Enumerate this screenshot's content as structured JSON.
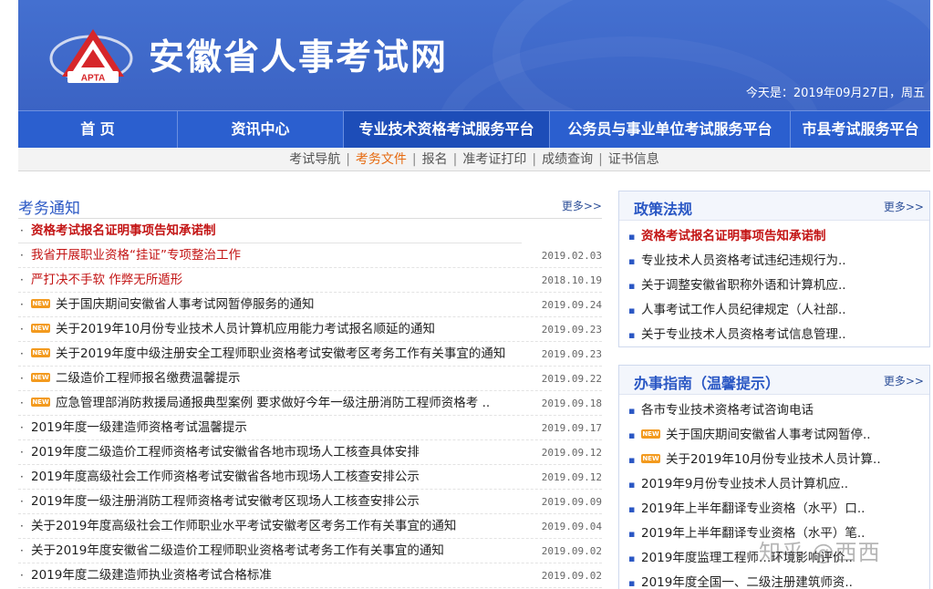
{
  "header": {
    "site_title": "安徽省人事考试网",
    "logo_text": "APTA",
    "date_line": "今天是：2019年09月27日，周五"
  },
  "main_nav": [
    {
      "label": "首  页"
    },
    {
      "label": "资讯中心"
    },
    {
      "label": "专业技术资格考试服务平台"
    },
    {
      "label": "公务员与事业单位考试服务平台"
    },
    {
      "label": "市县考试服务平台"
    }
  ],
  "sub_nav": [
    {
      "label": "考试导航"
    },
    {
      "label": "考务文件"
    },
    {
      "label": "报名"
    },
    {
      "label": "准考证打印"
    },
    {
      "label": "成绩查询"
    },
    {
      "label": "证书信息"
    }
  ],
  "exam_notice": {
    "title": "考务通知",
    "more": "更多>>",
    "items": [
      {
        "text": "资格考试报名证明事项告知承诺制",
        "date": ""
      },
      {
        "text": "我省开展职业资格“挂证”专项整治工作",
        "date": "2019.02.03"
      },
      {
        "text": "严打决不手软 作弊无所遁形",
        "date": "2018.10.19"
      },
      {
        "text": "关于国庆期间安徽省人事考试网暂停服务的通知",
        "date": "2019.09.24",
        "new": "NEW"
      },
      {
        "text": "关于2019年10月份专业技术人员计算机应用能力考试报名顺延的通知",
        "date": "2019.09.23",
        "new": "NEW"
      },
      {
        "text": "关于2019年度中级注册安全工程师职业资格考试安徽考区考务工作有关事宜的通知",
        "date": "2019.09.23",
        "new": "NEW"
      },
      {
        "text": "二级造价工程师报名缴费温馨提示",
        "date": "2019.09.22",
        "new": "NEW"
      },
      {
        "text": "应急管理部消防救援局通报典型案例 要求做好今年一级注册消防工程师资格考 ..",
        "date": "2019.09.18",
        "new": "NEW"
      },
      {
        "text": "2019年度一级建造师资格考试温馨提示",
        "date": "2019.09.17"
      },
      {
        "text": "2019年度二级造价工程师资格考试安徽省各地市现场人工核查具体安排",
        "date": "2019.09.12"
      },
      {
        "text": "2019年度高级社会工作师资格考试安徽省各地市现场人工核查安排公示",
        "date": "2019.09.12"
      },
      {
        "text": "2019年度一级注册消防工程师资格考试安徽考区现场人工核查安排公示",
        "date": "2019.09.09"
      },
      {
        "text": "关于2019年度高级社会工作师职业水平考试安徽考区考务工作有关事宜的通知",
        "date": "2019.09.04"
      },
      {
        "text": "关于2019年度安徽省二级造价工程师职业资格考试考务工作有关事宜的通知",
        "date": "2019.09.02"
      },
      {
        "text": "2019年度二级建造师执业资格考试合格标准",
        "date": "2019.09.02"
      }
    ]
  },
  "policy": {
    "title": "政策法规",
    "more": "更多>>",
    "items": [
      {
        "text": "资格考试报名证明事项告知承诺制"
      },
      {
        "text": "专业技术人员资格考试违纪违规行为.."
      },
      {
        "text": "关于调整安徽省职称外语和计算机应.."
      },
      {
        "text": "人事考试工作人员纪律规定（人社部.."
      },
      {
        "text": "关于专业技术人员资格考试信息管理.."
      }
    ]
  },
  "guide": {
    "title": "办事指南（温馨提示）",
    "more": "更多>>",
    "items": [
      {
        "text": "各市专业技术资格考试咨询电话"
      },
      {
        "text": "关于国庆期间安徽省人事考试网暂停..",
        "new": "NEW"
      },
      {
        "text": "关于2019年10月份专业技术人员计算..",
        "new": "NEW"
      },
      {
        "text": "2019年9月份专业技术人员计算机应.."
      },
      {
        "text": "2019年上半年翻译专业资格（水平）口.."
      },
      {
        "text": "2019年上半年翻译专业资格（水平）笔.."
      },
      {
        "text": "2019年度监理工程师…环境影响评价.."
      },
      {
        "text": "2019年度全国一、二级注册建筑师资.."
      }
    ]
  },
  "watermark": "知乎 @西西",
  "colors": {
    "brand_blue": "#3e67c9",
    "nav_blue": "#2b5fcf",
    "accent_orange": "#e66a10",
    "alert_red": "#c31414"
  }
}
